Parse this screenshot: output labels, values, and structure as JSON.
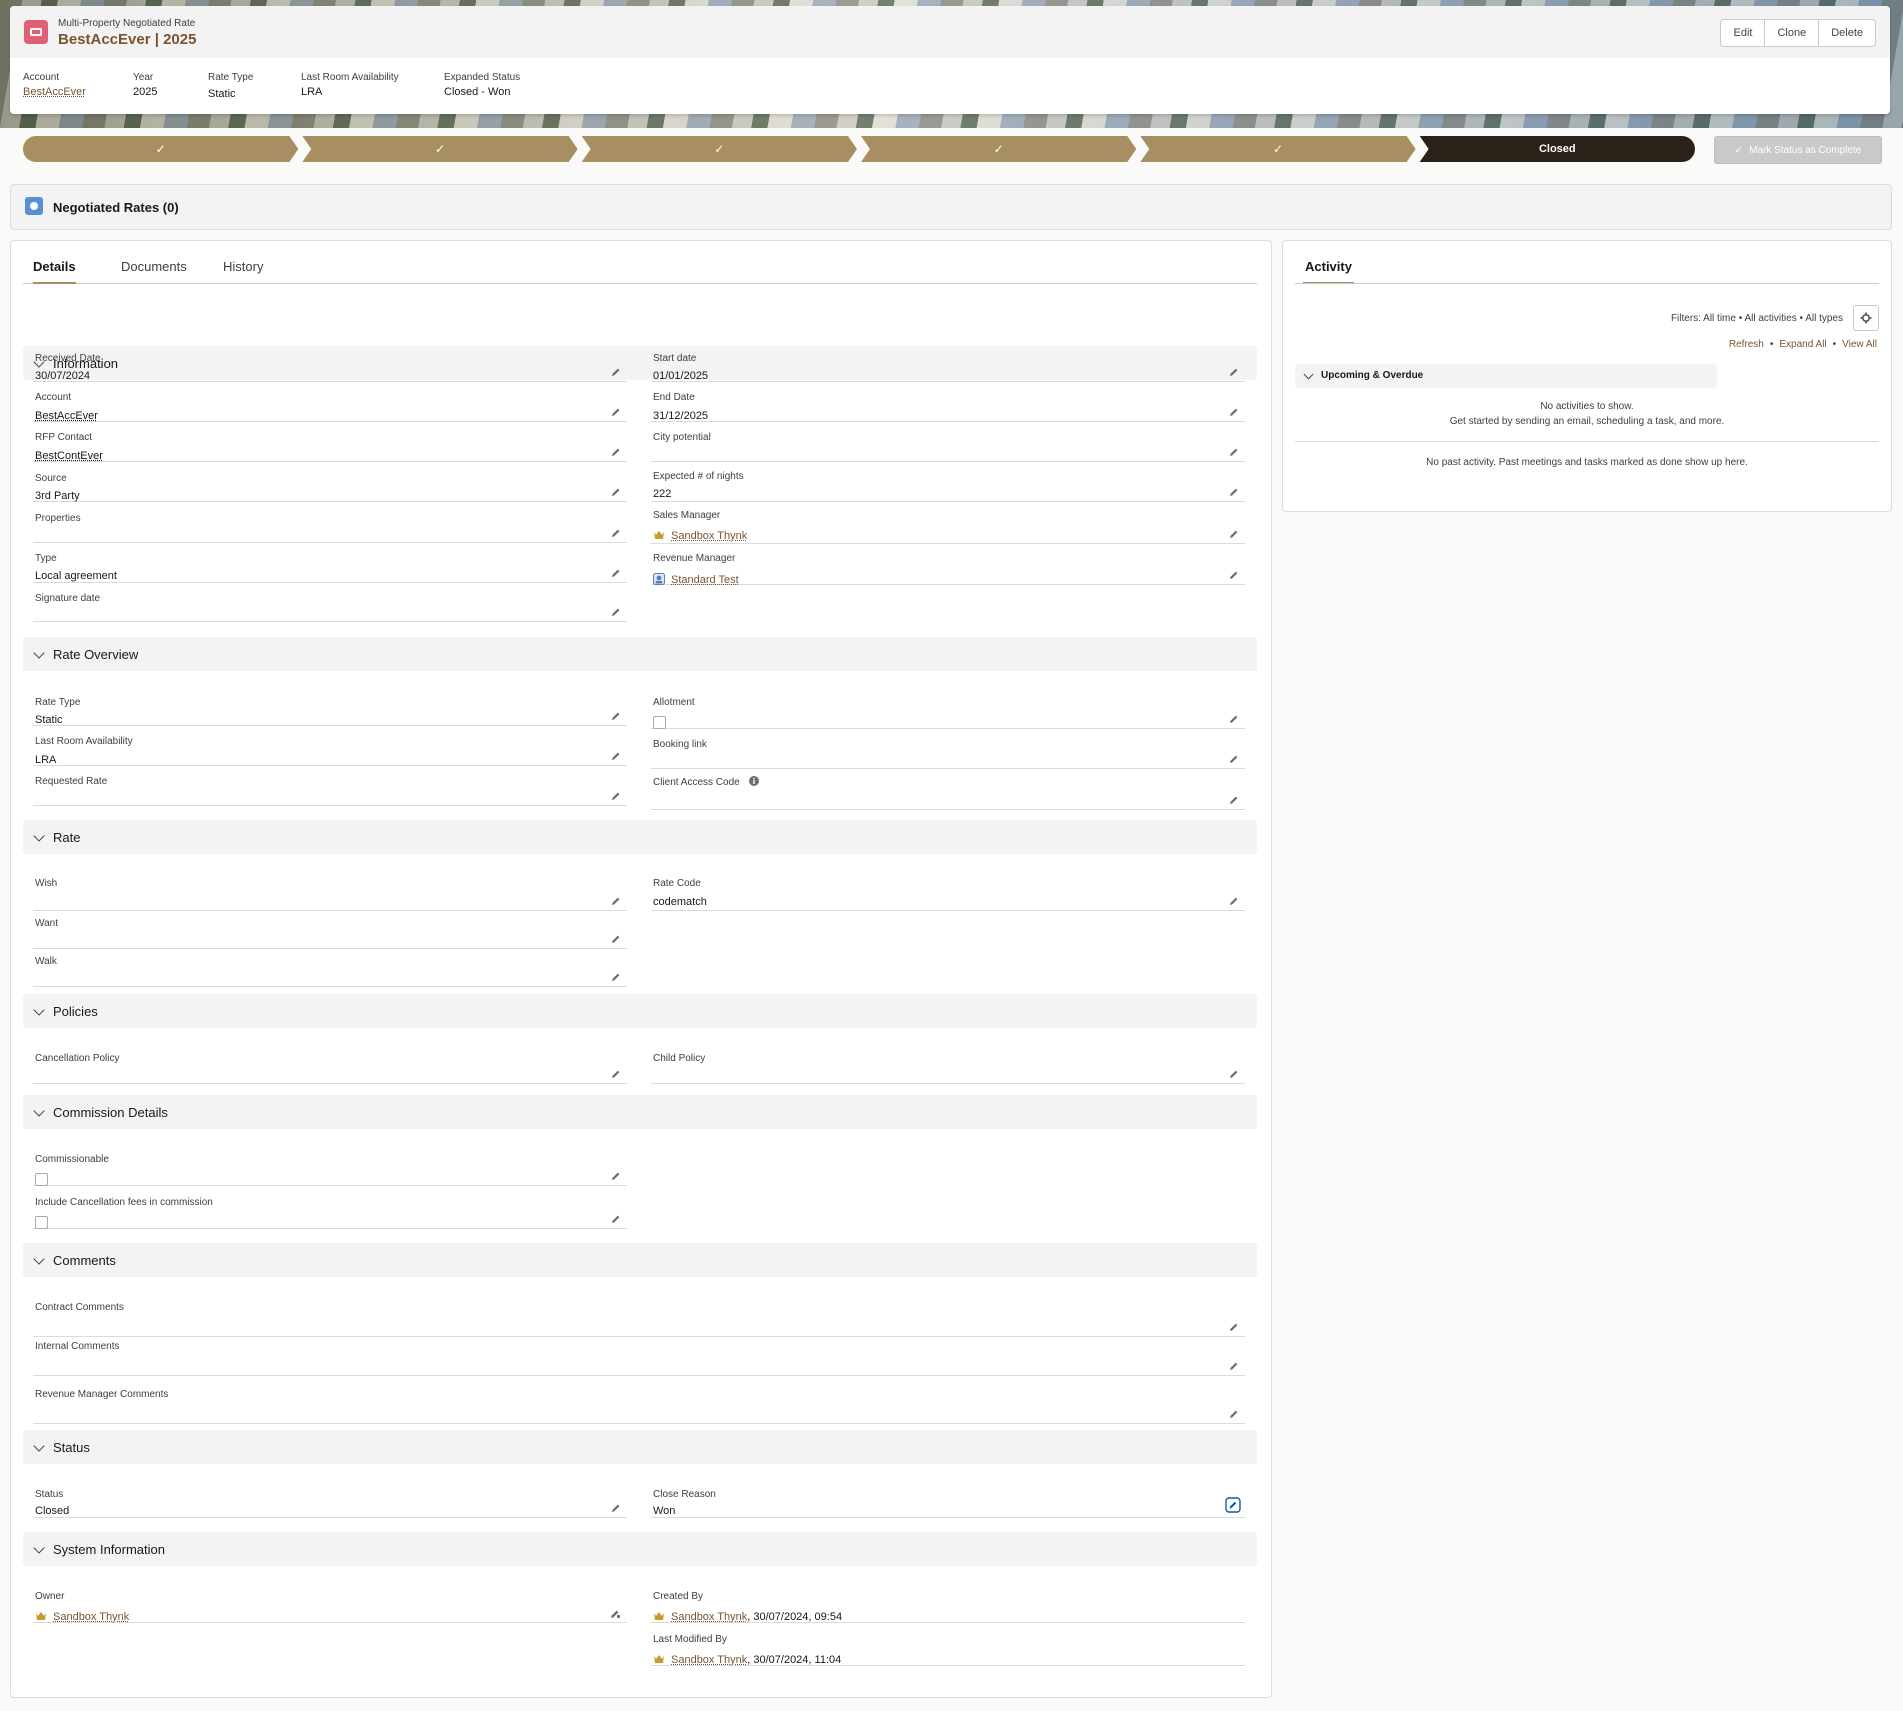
{
  "header": {
    "object_label": "Multi-Property Negotiated Rate",
    "title": "BestAccEver | 2025",
    "actions": {
      "edit": "Edit",
      "clone": "Clone",
      "delete": "Delete"
    },
    "highlights": {
      "account_label": "Account",
      "account_value": "BestAccEver",
      "year_label": "Year",
      "year_value": "2025",
      "rate_type_label": "Rate Type",
      "rate_type_value": "Static",
      "lra_label": "Last Room Availability",
      "lra_value": "LRA",
      "expanded_status_label": "Expanded Status",
      "expanded_status_value": "Closed - Won"
    }
  },
  "path": {
    "steps": [
      "✓",
      "✓",
      "✓",
      "✓",
      "✓",
      "Closed"
    ],
    "complete_button": "Mark Status as Complete"
  },
  "related": {
    "title": "Negotiated Rates (0)"
  },
  "tabs": {
    "details": "Details",
    "documents": "Documents",
    "history": "History"
  },
  "sections": {
    "information": "Information",
    "rate_overview": "Rate Overview",
    "rate": "Rate",
    "policies": "Policies",
    "commission": "Commission Details",
    "comments": "Comments",
    "status": "Status",
    "system": "System Information"
  },
  "fields": {
    "received_date": {
      "label": "Received Date",
      "value": "30/07/2024"
    },
    "start_date": {
      "label": "Start date",
      "value": "01/01/2025"
    },
    "account": {
      "label": "Account",
      "value": "BestAccEver"
    },
    "end_date": {
      "label": "End Date",
      "value": "31/12/2025"
    },
    "rfp_contact": {
      "label": "RFP Contact",
      "value": "BestContEver"
    },
    "city_potential": {
      "label": "City potential",
      "value": ""
    },
    "source": {
      "label": "Source",
      "value": "3rd Party"
    },
    "expected_nights": {
      "label": "Expected # of nights",
      "value": "222"
    },
    "properties": {
      "label": "Properties",
      "value": ""
    },
    "sales_manager": {
      "label": "Sales Manager",
      "value": "Sandbox Thynk"
    },
    "type": {
      "label": "Type",
      "value": "Local agreement"
    },
    "revenue_manager": {
      "label": "Revenue Manager",
      "value": "Standard Test"
    },
    "signature_date": {
      "label": "Signature date",
      "value": ""
    },
    "rate_type": {
      "label": "Rate Type",
      "value": "Static"
    },
    "allotment": {
      "label": "Allotment",
      "value": ""
    },
    "lra": {
      "label": "Last Room Availability",
      "value": "LRA"
    },
    "booking_link": {
      "label": "Booking link",
      "value": ""
    },
    "requested_rate": {
      "label": "Requested Rate",
      "value": ""
    },
    "client_access_code": {
      "label": "Client Access Code",
      "value": ""
    },
    "wish": {
      "label": "Wish",
      "value": ""
    },
    "rate_code": {
      "label": "Rate Code",
      "value": "codematch"
    },
    "want": {
      "label": "Want",
      "value": ""
    },
    "walk": {
      "label": "Walk",
      "value": ""
    },
    "cancellation_policy": {
      "label": "Cancellation Policy",
      "value": ""
    },
    "child_policy": {
      "label": "Child Policy",
      "value": ""
    },
    "commissionable": {
      "label": "Commissionable",
      "value": ""
    },
    "include_cancellation": {
      "label": "Include Cancellation fees in commission",
      "value": ""
    },
    "contract_comments": {
      "label": "Contract Comments",
      "value": ""
    },
    "internal_comments": {
      "label": "Internal Comments",
      "value": ""
    },
    "rm_comments": {
      "label": "Revenue Manager Comments",
      "value": ""
    },
    "status": {
      "label": "Status",
      "value": "Closed"
    },
    "close_reason": {
      "label": "Close Reason",
      "value": "Won"
    },
    "owner": {
      "label": "Owner",
      "value": "Sandbox Thynk"
    },
    "created_by": {
      "label": "Created By",
      "value": "Sandbox Thynk",
      "suffix": ", 30/07/2024, 09:54"
    },
    "last_modified_by": {
      "label": "Last Modified By",
      "value": "Sandbox Thynk",
      "suffix": ", 30/07/2024, 11:04"
    }
  },
  "activity": {
    "tab": "Activity",
    "filters": "Filters: All time • All activities • All types",
    "refresh": "Refresh",
    "expand_all": "Expand All",
    "view_all": "View All",
    "upcoming_title": "Upcoming & Overdue",
    "no_activities": "No activities to show.",
    "get_started": "Get started by sending an email, scheduling a task, and more.",
    "no_past": "No past activity. Past meetings and tasks marked as done show up here."
  },
  "colors": {
    "accent": "#a88f62",
    "path_current": "#2a2118",
    "object_icon": "#e05f75",
    "link": "#7a5430"
  }
}
